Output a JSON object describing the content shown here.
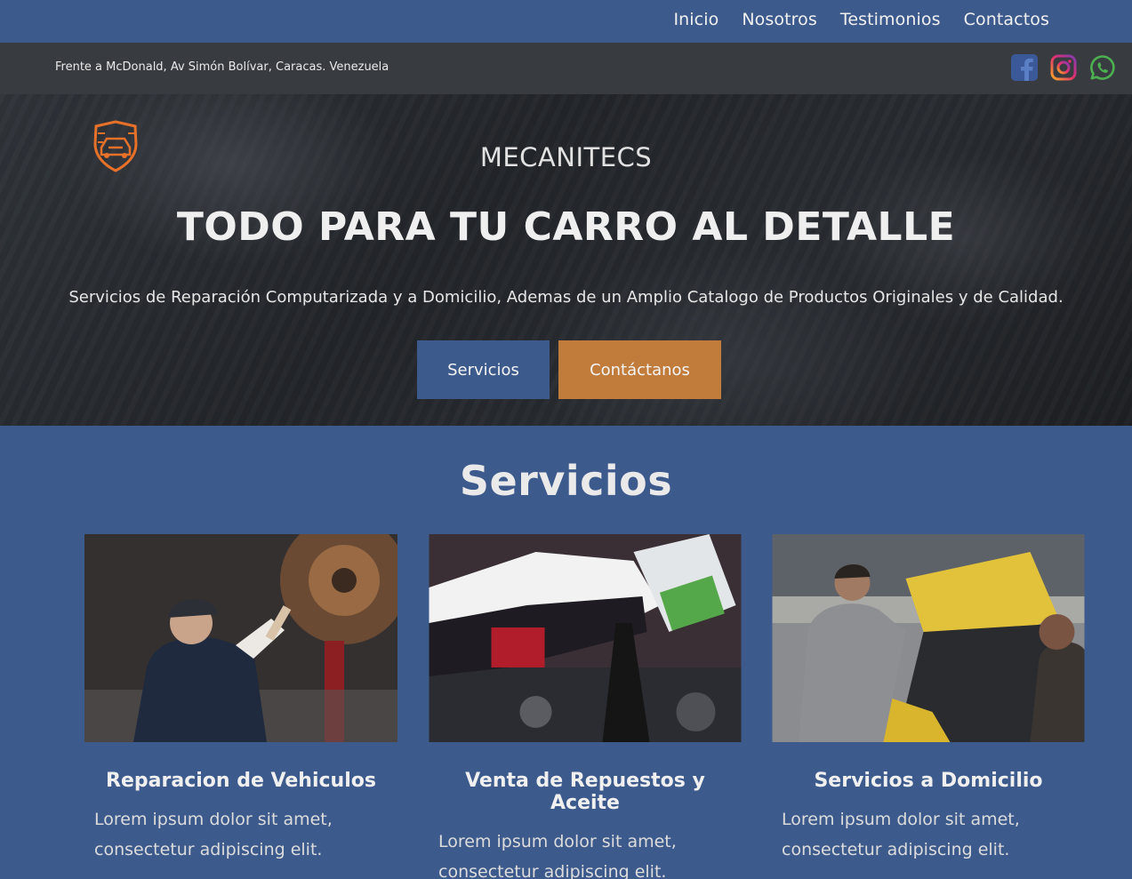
{
  "nav": {
    "items": [
      {
        "label": "Inicio"
      },
      {
        "label": "Nosotros"
      },
      {
        "label": "Testimonios"
      },
      {
        "label": "Contactos"
      }
    ]
  },
  "topbar": {
    "address": "Frente a McDonald, Av Simón Bolívar, Caracas. Venezuela",
    "socials": [
      {
        "icon": "facebook-icon",
        "color": "#3b5998"
      },
      {
        "icon": "instagram-icon",
        "color": "#e1306c"
      },
      {
        "icon": "whatsapp-icon",
        "color": "#4caf50"
      }
    ]
  },
  "hero": {
    "brand": "MECANITECS",
    "title": "TODO PARA TU CARRO AL DETALLE",
    "subtitle": "Servicios de Reparación Computarizada y a Domicilio, Ademas de un Amplio Catalogo de Productos Originales y de Calidad.",
    "btn_primary": "Servicios",
    "btn_secondary": "Contáctanos",
    "logo_icon": "shield-car-logo-icon"
  },
  "services": {
    "title": "Servicios",
    "cards": [
      {
        "title": "Reparacion de Vehiculos",
        "text": "Lorem ipsum dolor sit amet, consectetur adipiscing elit."
      },
      {
        "title": "Venta de Repuestos y Aceite",
        "text": "Lorem ipsum dolor sit amet, consectetur adipiscing elit."
      },
      {
        "title": "Servicios a Domicilio",
        "text": "Lorem ipsum dolor sit amet, consectetur adipiscing elit."
      }
    ]
  },
  "colors": {
    "primary": "#3d5a8c",
    "accent": "#c17c3c",
    "topbar": "#383c40",
    "logo": "#e8712a"
  }
}
